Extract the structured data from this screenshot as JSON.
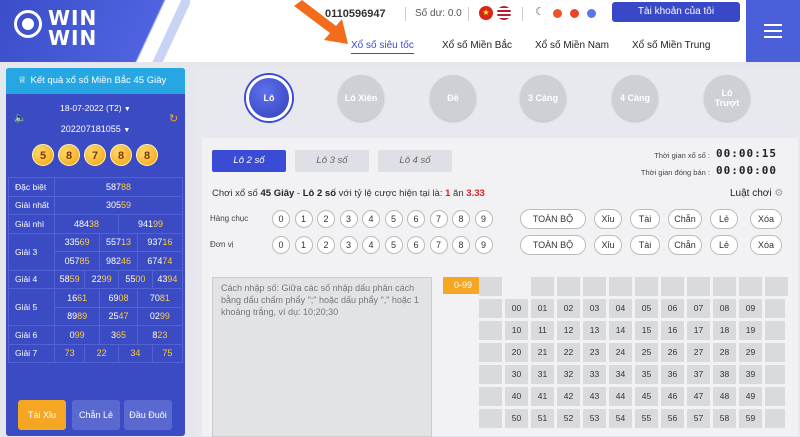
{
  "header": {
    "logo_text_1": "WIN",
    "logo_text_2": "WIN",
    "phone": "0110596947",
    "balance": "Số dư: 0.0",
    "account_button": "Tài khoản của tôi",
    "nav": [
      "Xổ số siêu tốc",
      "Xổ số Miền Bắc",
      "Xổ số Miền Nam",
      "Xổ số Miền Trung"
    ]
  },
  "left_panel": {
    "title": "Kết quả xổ số Miền Bắc 45 Giây",
    "date": "18-07-2022 (T2)",
    "draw_id": "202207181055",
    "balls": [
      "5",
      "8",
      "7",
      "8",
      "8"
    ],
    "results": [
      {
        "label": "Đặc biệt",
        "rows": [
          [
            [
              "587",
              "88"
            ]
          ]
        ]
      },
      {
        "label": "Giải nhất",
        "rows": [
          [
            [
              "305",
              "59"
            ]
          ]
        ]
      },
      {
        "label": "Giải nhì",
        "rows": [
          [
            [
              "484",
              "38"
            ],
            [
              "941",
              "99"
            ]
          ]
        ]
      },
      {
        "label": "Giải 3",
        "rows": [
          [
            [
              "335",
              "69"
            ],
            [
              "557",
              "13"
            ],
            [
              "937",
              "16"
            ]
          ],
          [
            [
              "057",
              "85"
            ],
            [
              "982",
              "46"
            ],
            [
              "674",
              "74"
            ]
          ]
        ]
      },
      {
        "label": "Giải 4",
        "rows": [
          [
            [
              "58",
              "59"
            ],
            [
              "22",
              "99"
            ],
            [
              "55",
              "00"
            ],
            [
              "43",
              "94"
            ]
          ]
        ]
      },
      {
        "label": "Giải 5",
        "rows": [
          [
            [
              "16",
              "61"
            ],
            [
              "69",
              "08"
            ],
            [
              "70",
              "81"
            ]
          ],
          [
            [
              "89",
              "89"
            ],
            [
              "25",
              "47"
            ],
            [
              "02",
              "99"
            ]
          ]
        ]
      },
      {
        "label": "Giải 6",
        "rows": [
          [
            [
              "0",
              "99"
            ],
            [
              "3",
              "65"
            ],
            [
              "8",
              "23"
            ]
          ]
        ]
      },
      {
        "label": "Giải 7",
        "rows": [
          [
            [
              "",
              "73"
            ],
            [
              "",
              "22"
            ],
            [
              "",
              "34"
            ],
            [
              "",
              "75"
            ]
          ]
        ]
      }
    ],
    "tabs": [
      "Tài Xỉu",
      "Chẵn Lẻ",
      "Đầu Đuôi"
    ]
  },
  "game_types": [
    "Lô",
    "Lô Xiên",
    "Đề",
    "3 Càng",
    "4 Càng",
    "Lô Trượt"
  ],
  "sub_tabs": [
    "Lô 2 số",
    "Lô 3 số",
    "Lô 4 số"
  ],
  "timers": {
    "draw_time_label": "Thời gian xổ số :",
    "draw_time": "00:00:15",
    "close_time_label": "Thời gian đóng bán :",
    "close_time": "00:00:00"
  },
  "info": {
    "prefix": "Chơi xổ số ",
    "game": "45 Giây",
    "dash": " - ",
    "type": "Lô 2 số",
    "middle": " với tỷ lệ cược hiện tại là: ",
    "ratio_a": "1",
    "ratio_mid": " ăn ",
    "ratio_b": "3.33",
    "rules": "Luật chơi"
  },
  "picker": {
    "row_labels": [
      "Hàng chục",
      "Đơn vị"
    ],
    "digits": [
      "0",
      "1",
      "2",
      "3",
      "4",
      "5",
      "6",
      "7",
      "8",
      "9"
    ],
    "quick": [
      "TOÀN BỘ",
      "Xỉu",
      "Tài",
      "Chẵn",
      "Lẻ",
      "Xóa"
    ]
  },
  "input": {
    "placeholder": "Cách nhập số: Giữa các số nhập dấu phân cách bằng dấu chấm phẩy \";\" hoặc dấu phẩy \",\" hoặc 1 khoảng trắng, ví dụ: 10;20;30",
    "range": "0-99"
  },
  "grid_numbers": [
    "00",
    "01",
    "02",
    "03",
    "04",
    "05",
    "06",
    "07",
    "08",
    "09",
    "10",
    "11",
    "12",
    "13",
    "14",
    "15",
    "16",
    "17",
    "18",
    "19",
    "20",
    "21",
    "22",
    "23",
    "24",
    "25",
    "26",
    "27",
    "28",
    "29",
    "30",
    "31",
    "32",
    "33",
    "34",
    "35",
    "36",
    "37",
    "38",
    "39",
    "40",
    "41",
    "42",
    "43",
    "44",
    "45",
    "46",
    "47",
    "48",
    "49",
    "50",
    "51",
    "52",
    "53",
    "54",
    "55",
    "56",
    "57",
    "58",
    "59"
  ],
  "colors": {
    "primary": "#3a4cd6",
    "accent": "#f5a623",
    "highlight": "#ffcc33",
    "arrow": "#f26c1b"
  }
}
